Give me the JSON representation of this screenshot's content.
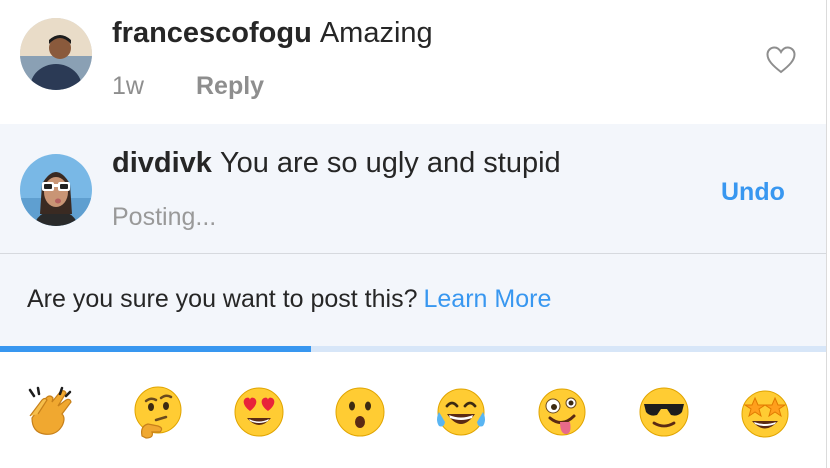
{
  "comment1": {
    "username": "francescofogu",
    "text": "Amazing",
    "time": "1w",
    "reply_label": "Reply"
  },
  "comment2": {
    "username": "divdivk",
    "text": "You are so ugly and stupid",
    "status": "Posting...",
    "undo_label": "Undo"
  },
  "warning": {
    "text": "Are you sure you want to post this?",
    "link": "Learn More"
  },
  "progress": {
    "fraction": 0.377
  },
  "colors": {
    "accent": "#3897f0",
    "pending_bg": "#f3f6fb",
    "meta_text": "#8e8e8e"
  },
  "emoji_bar": [
    {
      "icon": "clapping-hands-emoji"
    },
    {
      "icon": "thinking-face-emoji"
    },
    {
      "icon": "heart-eyes-emoji"
    },
    {
      "icon": "surprised-face-emoji"
    },
    {
      "icon": "tears-of-joy-emoji"
    },
    {
      "icon": "zany-face-emoji"
    },
    {
      "icon": "sunglasses-face-emoji"
    },
    {
      "icon": "star-struck-emoji"
    }
  ]
}
